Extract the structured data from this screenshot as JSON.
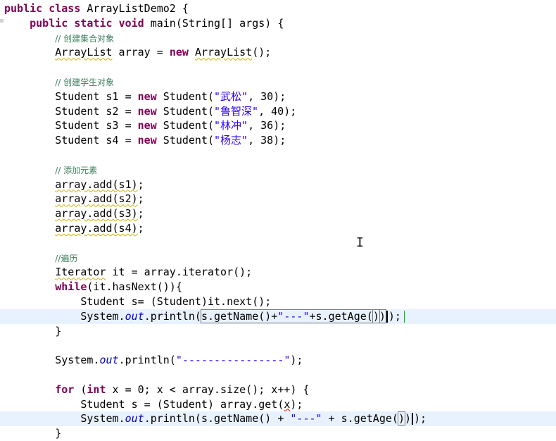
{
  "editor": {
    "lines": [
      {
        "text": "public class ArrayListDemo2 {"
      },
      {
        "text": "    public static void main(String[] args) {"
      },
      {
        "text": "        // 创建集合对象"
      },
      {
        "text": "        ArrayList array = new ArrayList();"
      },
      {
        "text": ""
      },
      {
        "text": "        // 创建学生对象"
      },
      {
        "text": "        Student s1 = new Student(\"武松\", 30);"
      },
      {
        "text": "        Student s2 = new Student(\"鲁智深\", 40);"
      },
      {
        "text": "        Student s3 = new Student(\"林冲\", 36);"
      },
      {
        "text": "        Student s4 = new Student(\"杨志\", 38);"
      },
      {
        "text": ""
      },
      {
        "text": "        // 添加元素"
      },
      {
        "text": "        array.add(s1);"
      },
      {
        "text": "        array.add(s2);"
      },
      {
        "text": "        array.add(s3);"
      },
      {
        "text": "        array.add(s4);"
      },
      {
        "text": ""
      },
      {
        "text": "        //遍历"
      },
      {
        "text": "        Iterator it = array.iterator();"
      },
      {
        "text": "        while(it.hasNext()){"
      },
      {
        "text": "            Student s= (Student)it.next();"
      },
      {
        "text": "            System.out.println(s.getName()+\"---\"+s.getAge());"
      },
      {
        "text": "        }"
      },
      {
        "text": ""
      },
      {
        "text": "        System.out.println(\"----------------\");"
      },
      {
        "text": ""
      },
      {
        "text": "        for (int x = 0; x < array.size(); x++) {"
      },
      {
        "text": "            Student s = (Student) array.get(x);"
      },
      {
        "text": "            System.out.println(s.getName() + \"---\" + s.getAge());"
      },
      {
        "text": "        }"
      }
    ],
    "current_lines": [
      21,
      28
    ]
  }
}
